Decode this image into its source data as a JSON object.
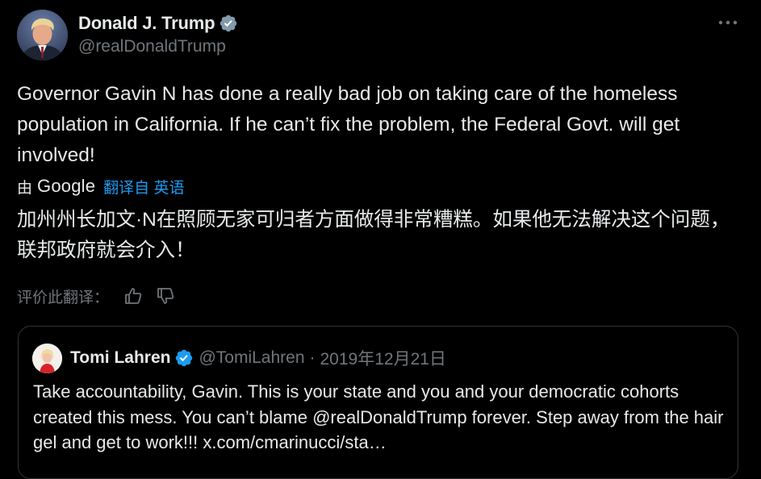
{
  "tweet": {
    "author": {
      "display_name": "Donald J. Trump",
      "handle": "@realDonaldTrump",
      "avatar_icon": "avatar-photo",
      "verified_icon": "verified-badge-icon"
    },
    "text": "Governor Gavin N has done a really bad job on taking care of the homeless population in California. If he can’t fix the problem, the Federal Govt. will get involved!",
    "translation": {
      "by_label": "由",
      "provider": "Google",
      "link_label": "翻译自 英语",
      "text": "加州州长加文·N在照顾无家可归者方面做得非常糟糕。如果他无法解决这个问题，联邦政府就会介入！",
      "rate_label": "评价此翻译："
    },
    "more_icon": "more-options-icon"
  },
  "quote": {
    "display_name": "Tomi Lahren",
    "handle": "@TomiLahren",
    "separator": "·",
    "date": "2019年12月21日",
    "text": "Take accountability, Gavin. This is your state and you and your democratic cohorts created this mess. You can’t blame @realDonaldTrump forever. Step away from the hair gel and get to work!!! x.com/cmarinucci/sta…"
  },
  "colors": {
    "background": "#000000",
    "text": "#e7e9ea",
    "secondary_text": "#71767b",
    "accent": "#1d9bf0",
    "border": "#2f3336"
  }
}
